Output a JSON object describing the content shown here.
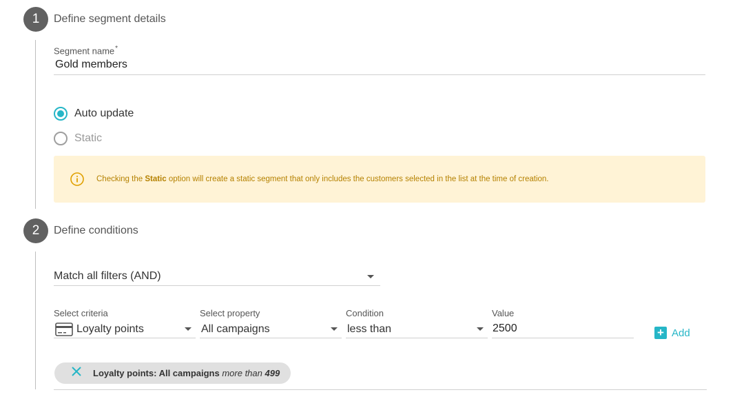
{
  "step1": {
    "number": "1",
    "title": "Define segment details",
    "segment_name_label": "Segment name",
    "required_mark": "*",
    "segment_name_value": "Gold members",
    "radio_auto": "Auto update",
    "radio_static": "Static",
    "notice_prefix": "Checking the ",
    "notice_bold": "Static",
    "notice_suffix": " option will create a static segment that only includes the customers selected in the list at the time of creation."
  },
  "step2": {
    "number": "2",
    "title": "Define conditions",
    "match_select": "Match all filters (AND)",
    "criteria_label": "Select criteria",
    "criteria_value": "Loyalty points",
    "property_label": "Select property",
    "property_value": "All campaigns",
    "condition_label": "Condition",
    "condition_value": "less than",
    "value_label": "Value",
    "value_value": "2500",
    "add_label": "Add",
    "chip": {
      "bold": "Loyalty points: All campaigns",
      "italic": "more than",
      "number": "499"
    }
  },
  "colors": {
    "accent": "#26b6c7",
    "notice_bg": "#fff3d6",
    "notice_text": "#b58100",
    "step_circle": "#616161"
  },
  "icons": {
    "notice": "info-circle-icon",
    "criteria": "credit-card-icon",
    "add": "plus-box-icon",
    "chip_remove": "close-icon"
  }
}
